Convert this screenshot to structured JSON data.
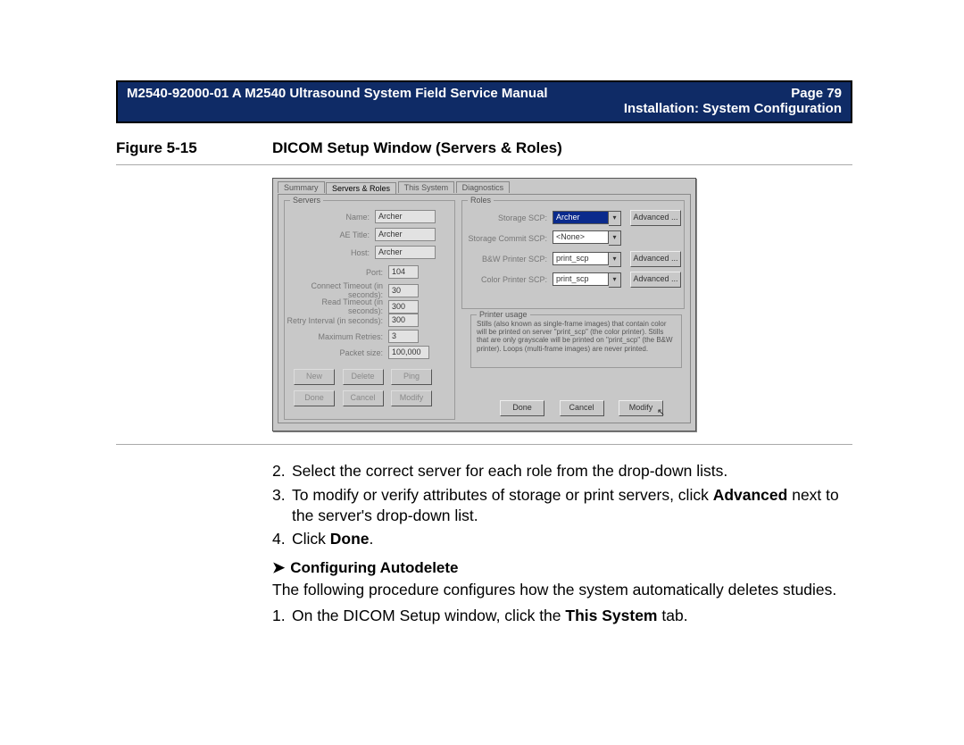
{
  "header": {
    "left": "M2540-92000-01 A M2540 Ultrasound System Field Service Manual",
    "right": "Page 79",
    "sub": "Installation: System Configuration"
  },
  "figure": {
    "label": "Figure 5-15",
    "title": "DICOM Setup Window (Servers & Roles)"
  },
  "win": {
    "tabs": [
      "Summary",
      "Servers & Roles",
      "This System",
      "Diagnostics"
    ],
    "servers": {
      "legend": "Servers",
      "name_label": "Name:",
      "name": "Archer",
      "ae_label": "AE Title:",
      "ae": "Archer",
      "host_label": "Host:",
      "host": "Archer",
      "port_label": "Port:",
      "port": "104",
      "ct_label": "Connect Timeout (in seconds):",
      "ct": "30",
      "rt_label": "Read Timeout (in seconds):",
      "rt": "300",
      "ri_label": "Retry Interval (in seconds):",
      "ri": "300",
      "mr_label": "Maximum Retries:",
      "mr": "3",
      "ps_label": "Packet size:",
      "ps": "100,000",
      "buttons": [
        "New",
        "Delete",
        "Ping",
        "Done",
        "Cancel",
        "Modify"
      ]
    },
    "roles": {
      "legend": "Roles",
      "rows": [
        {
          "label": "Storage SCP:",
          "value": "Archer",
          "adv": "Advanced ...",
          "sel": true
        },
        {
          "label": "Storage Commit SCP:",
          "value": "<None>",
          "adv": ""
        },
        {
          "label": "B&W Printer SCP:",
          "value": "print_scp",
          "adv": "Advanced ..."
        },
        {
          "label": "Color Printer SCP:",
          "value": "print_scp",
          "adv": "Advanced ..."
        }
      ],
      "printer_legend": "Printer usage",
      "printer_text": "Stills (also known as single-frame images) that contain color will be printed on server \"print_scp\" (the color printer). Stills that are only grayscale will be printed on \"print_scp\" (the B&W printer). Loops (multi-frame images) are never printed.",
      "buttons": [
        "Done",
        "Cancel",
        "Modify"
      ]
    }
  },
  "steps": [
    {
      "n": "2.",
      "t1": "Select the correct server for each role from the drop-down lists."
    },
    {
      "n": "3.",
      "t1": "To modify or verify attributes of storage or print servers, click ",
      "b": "Advanced",
      "t2": " next to the server's drop-down list."
    },
    {
      "n": "4.",
      "t1": "Click ",
      "b": "Done",
      "t2": "."
    }
  ],
  "subsection": {
    "arrow": "➤",
    "title": "Configuring Autodelete"
  },
  "after": "The following procedure configures how the system automatically deletes studies.",
  "step1": {
    "n": "1.",
    "t1": "On the DICOM Setup window, click the ",
    "b": "This System",
    "t2": " tab."
  }
}
